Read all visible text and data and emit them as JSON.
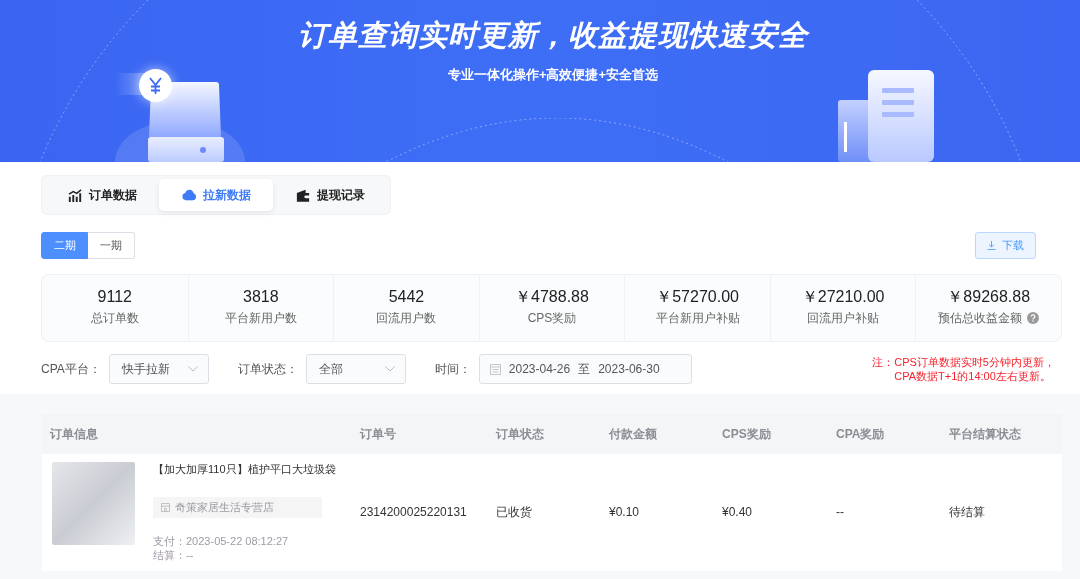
{
  "banner": {
    "title": "订单查询实时更新，收益提现快速安全",
    "subtitle": "专业一体化操作+高效便捷+安全首选"
  },
  "tabs": [
    {
      "label": "订单数据",
      "selected": false
    },
    {
      "label": "拉新数据",
      "selected": true
    },
    {
      "label": "提现记录",
      "selected": false
    }
  ],
  "periods": [
    {
      "label": "二期",
      "selected": true
    },
    {
      "label": "一期",
      "selected": false
    }
  ],
  "download_button": {
    "label": "下载"
  },
  "stats": [
    {
      "value": "9112",
      "label": "总订单数",
      "help": false
    },
    {
      "value": "3818",
      "label": "平台新用户数",
      "help": false
    },
    {
      "value": "5442",
      "label": "回流用户数",
      "help": false
    },
    {
      "value": "￥4788.88",
      "label": "CPS奖励",
      "help": false
    },
    {
      "value": "￥57270.00",
      "label": "平台新用户补贴",
      "help": false
    },
    {
      "value": "￥27210.00",
      "label": "回流用户补贴",
      "help": false
    },
    {
      "value": "￥89268.88",
      "label": "预估总收益金额",
      "help": true
    }
  ],
  "filters": [
    {
      "kind": "select",
      "label": "CPA平台：",
      "value": "快手拉新"
    },
    {
      "kind": "select",
      "label": "订单状态：",
      "value": "全部"
    },
    {
      "kind": "daterange",
      "label": "时间：",
      "start": "2023-04-26",
      "separator": "至",
      "end": "2023-06-30"
    }
  ],
  "note": {
    "prefix": "注：",
    "lines": [
      "CPS订单数据实时5分钟内更新，",
      "CPA数据T+1的14:00左右更新。"
    ]
  },
  "table": {
    "columns": [
      "订单信息",
      "订单号",
      "订单状态",
      "付款金额",
      "CPS奖励",
      "CPA奖励",
      "平台结算状态"
    ],
    "rows": [
      {
        "product": {
          "title": "【加大加厚110只】植护平口大垃圾袋",
          "shop": "奇策家居生活专营店",
          "paid": "支付：2023-05-22 08:12:27",
          "settled": "结算：--"
        },
        "order_no": "2314200025220131",
        "status": "已收货",
        "amount": "¥0.10",
        "cps_reward": "¥0.40",
        "cpa_reward": "--",
        "settlement": "待结算"
      }
    ]
  }
}
